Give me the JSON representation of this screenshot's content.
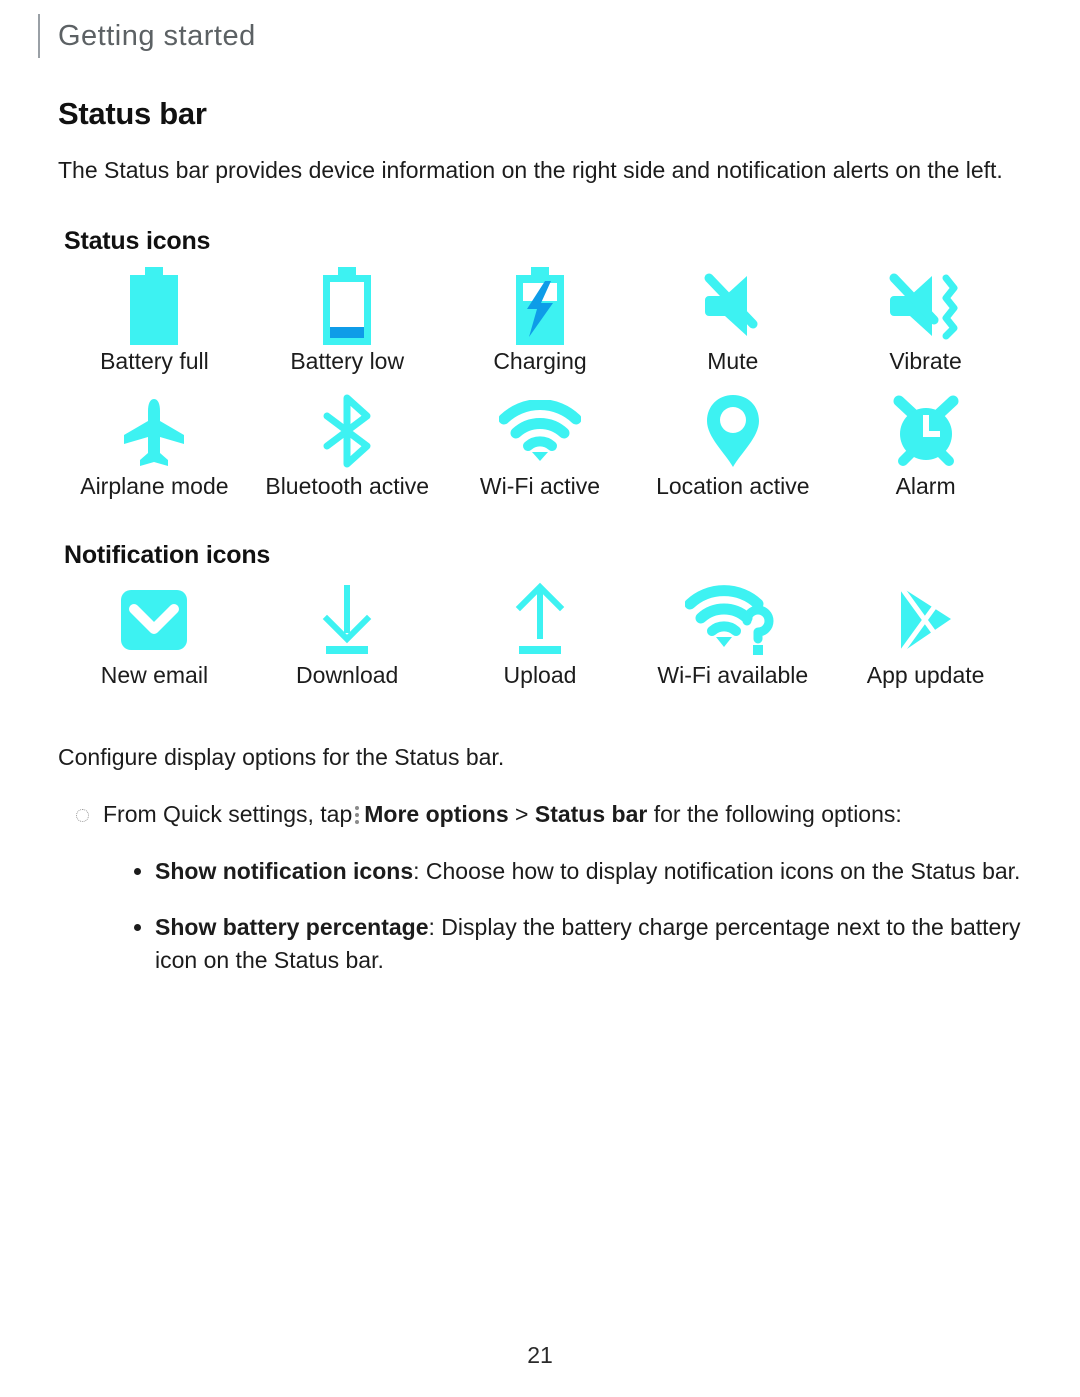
{
  "header": {
    "chapter_title": "Getting started"
  },
  "section": {
    "title": "Status bar",
    "intro": "The Status bar provides device information on the right side and notification alerts on the left."
  },
  "status_icons": {
    "heading": "Status icons",
    "row1": [
      {
        "icon": "battery-full-icon",
        "label": "Battery full"
      },
      {
        "icon": "battery-low-icon",
        "label": "Battery low"
      },
      {
        "icon": "charging-icon",
        "label": "Charging"
      },
      {
        "icon": "mute-icon",
        "label": "Mute"
      },
      {
        "icon": "vibrate-icon",
        "label": "Vibrate"
      }
    ],
    "row2": [
      {
        "icon": "airplane-mode-icon",
        "label": "Airplane mode"
      },
      {
        "icon": "bluetooth-active-icon",
        "label": "Bluetooth active"
      },
      {
        "icon": "wifi-active-icon",
        "label": "Wi-Fi active"
      },
      {
        "icon": "location-active-icon",
        "label": "Location active"
      },
      {
        "icon": "alarm-icon",
        "label": "Alarm"
      }
    ]
  },
  "notification_icons": {
    "heading": "Notification icons",
    "row1": [
      {
        "icon": "new-email-icon",
        "label": "New email"
      },
      {
        "icon": "download-icon",
        "label": "Download"
      },
      {
        "icon": "upload-icon",
        "label": "Upload"
      },
      {
        "icon": "wifi-available-icon",
        "label": "Wi-Fi available"
      },
      {
        "icon": "app-update-icon",
        "label": "App update"
      }
    ]
  },
  "instructions": {
    "intro": "Configure display options for the Status bar.",
    "step": {
      "lead": "From Quick settings, tap",
      "kebab_icon": "more-options-icon",
      "bold_1": "More options",
      "separator": ">",
      "bold_2": "Status bar",
      "tail": "for the following options:"
    },
    "options": [
      {
        "term": "Show notification icons",
        "description": ": Choose how to display notification icons on the Status bar."
      },
      {
        "term": "Show battery percentage",
        "description": ": Display the battery charge percentage next to the battery icon on the Status bar."
      }
    ]
  },
  "footer": {
    "page_number": "21"
  },
  "colors": {
    "icon_cyan": "#3DF2F2",
    "icon_blue": "#0E9CE8",
    "header_gray": "#5C6164",
    "rule_gray": "#9AA0A6",
    "text_black": "#1C1C1C"
  }
}
